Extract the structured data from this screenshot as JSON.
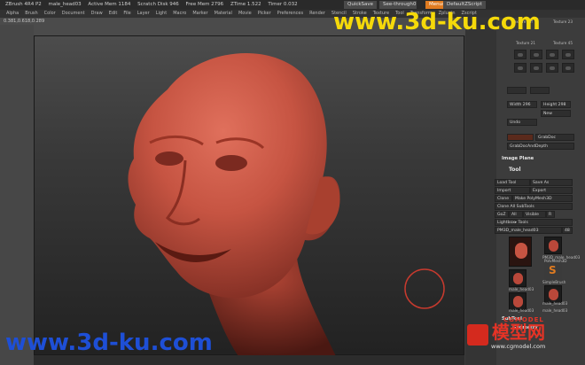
{
  "titlebar": {
    "app": "ZBrush 4R4 P2",
    "doc": "male_head03",
    "stats": [
      "Active Mem 1184",
      "Scratch Disk 946",
      "Free Mem 2796",
      "ZTime 1.522",
      "Timer 0.032"
    ],
    "quicksave": "QuickSave",
    "seethrough": "See-through",
    "seethrough_val": "0",
    "menus": "Menus",
    "script": "DefaultZScript"
  },
  "menubar": [
    "Alpha",
    "Brush",
    "Color",
    "Document",
    "Draw",
    "Edit",
    "File",
    "Layer",
    "Light",
    "Macro",
    "Marker",
    "Material",
    "Movie",
    "Picker",
    "Preferences",
    "Render",
    "Stencil",
    "Stroke",
    "Texture",
    "Tool",
    "Transform",
    "Zplugin",
    "Zscript"
  ],
  "coords": "0.381,0.618,0.289",
  "watermark": {
    "top": "www.3d-ku.com",
    "bottom": "www.3d-ku.com"
  },
  "rightpanel": {
    "top_thumbs": [
      "Texture Off",
      "Texture 23"
    ],
    "brush_caps": [
      "Texture 21",
      "Texture 45"
    ],
    "width_label": "Width 296",
    "height_label": "Height 298",
    "new_label": "New",
    "undo_label": "Undo",
    "grabdoc": "GrabDoc",
    "grabdoc_depth": "GrabDocAndDepth",
    "image_plane": "Image Plane",
    "tool_title": "Tool",
    "tool_buttons": [
      [
        "Load Tool",
        "Save As"
      ],
      [
        "Import",
        "Export"
      ],
      [
        "Clone",
        "Make PolyMesh3D"
      ],
      [
        "Clone All SubTools"
      ],
      [
        "GoZ",
        "All",
        "Visible",
        "R"
      ],
      [
        "Lightbox▸ Tools"
      ],
      [
        "PM3D_male_head03",
        "48"
      ]
    ],
    "tool_thumbs": [
      "PM3D_male_head03",
      "PolyMesh3D",
      "SimpleBrush",
      "male_head03",
      "male_head03",
      "male_head03",
      "male_head03"
    ],
    "subtool": "SubTool",
    "geometry": "Geometry"
  },
  "cgmodel": {
    "name": "模型网",
    "sub": "CGMODEL",
    "url": "www.cgmodel.com"
  }
}
